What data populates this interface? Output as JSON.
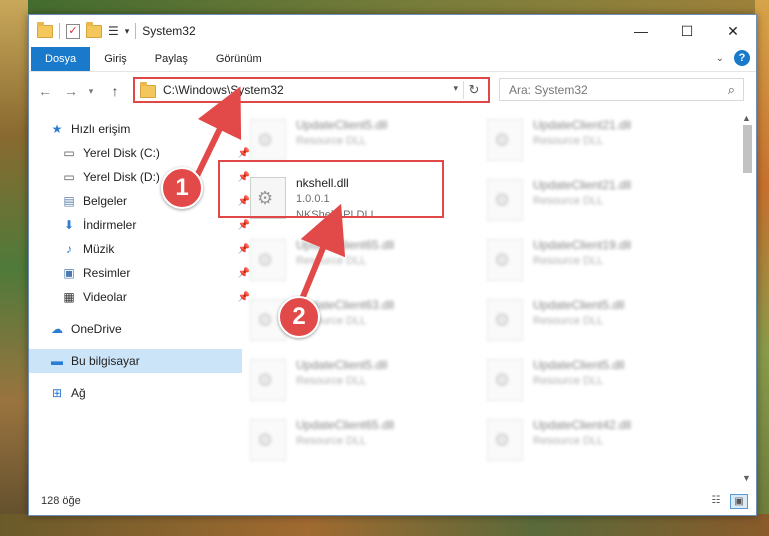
{
  "window": {
    "title": "System32"
  },
  "ribbon": {
    "tabs": [
      "Dosya",
      "Giriş",
      "Paylaş",
      "Görünüm"
    ],
    "help": "?"
  },
  "navbar": {
    "address": "C:\\Windows\\System32",
    "search_placeholder": "Ara: System32"
  },
  "sidebar": {
    "items": [
      {
        "label": "Hızlı erişim",
        "icon": "star-icon",
        "pinned": false
      },
      {
        "label": "Yerel Disk (C:)",
        "icon": "drive-icon",
        "pinned": true
      },
      {
        "label": "Yerel Disk (D:)",
        "icon": "drive-icon",
        "pinned": true
      },
      {
        "label": "Belgeler",
        "icon": "documents-icon",
        "pinned": true
      },
      {
        "label": "İndirmeler",
        "icon": "download-icon",
        "pinned": true
      },
      {
        "label": "Müzik",
        "icon": "music-icon",
        "pinned": true
      },
      {
        "label": "Resimler",
        "icon": "pictures-icon",
        "pinned": true
      },
      {
        "label": "Videolar",
        "icon": "videos-icon",
        "pinned": true
      },
      {
        "label": "OneDrive",
        "icon": "cloud-icon",
        "pinned": false
      },
      {
        "label": "Bu bilgisayar",
        "icon": "computer-icon",
        "pinned": false
      },
      {
        "label": "Ağ",
        "icon": "network-icon",
        "pinned": false
      }
    ]
  },
  "files": {
    "focused": {
      "name": "nkshell.dll",
      "version": "1.0.0.1",
      "description": "NKShellAPI DLL"
    },
    "background": [
      {
        "name": "UpdateClient5.dll",
        "type": "Resource DLL"
      },
      {
        "name": "UpdateClient21.dll",
        "type": "Resource DLL"
      },
      {
        "name": "UpdateClient21.dll",
        "type": "Resource DLL"
      },
      {
        "name": "UpdateClient65.dll",
        "type": "Resource DLL"
      },
      {
        "name": "UpdateClient19.dll",
        "type": "Resource DLL"
      },
      {
        "name": "UpdateClient63.dll",
        "type": "Resource DLL"
      },
      {
        "name": "UpdateClient5.dll",
        "type": "Resource DLL"
      },
      {
        "name": "UpdateClient5.dll",
        "type": "Resource DLL"
      },
      {
        "name": "UpdateClient5.dll",
        "type": "Resource DLL"
      },
      {
        "name": "UpdateClient65.dll",
        "type": "Resource DLL"
      },
      {
        "name": "UpdateClient42.dll",
        "type": "Resource DLL"
      }
    ]
  },
  "status": {
    "count": "128 öğe"
  },
  "annotations": {
    "marker1": "1",
    "marker2": "2",
    "color": "#e24a4a"
  }
}
